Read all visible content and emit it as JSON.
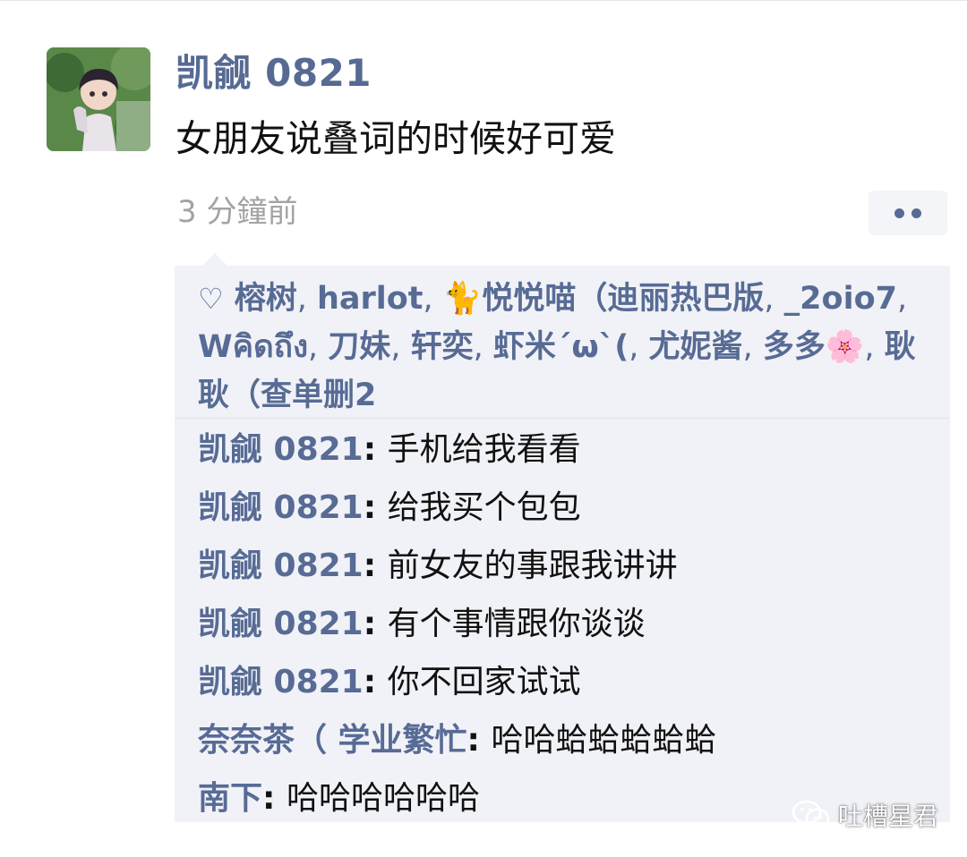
{
  "post": {
    "author": "凯觎 0821",
    "text": "女朋友说叠词的时候好可爱",
    "timestamp": "3 分鐘前"
  },
  "icons": {
    "avatar": "anime-character-avatar",
    "more": "more-dots-icon",
    "like": "heart-outline-icon"
  },
  "likes": {
    "names": [
      "榕树",
      "harlot",
      "🐈悦悦喵（迪丽热巴版",
      "_2oio7",
      "Wคิดถึง",
      "刀妹",
      "轩奕",
      "虾米´ω`(",
      "尤妮酱",
      "多多🌸",
      "耿耿（查单删2"
    ]
  },
  "comments": [
    {
      "author": "凯觎 0821",
      "text": "手机给我看看"
    },
    {
      "author": "凯觎 0821",
      "text": "给我买个包包"
    },
    {
      "author": "凯觎 0821",
      "text": "前女友的事跟我讲讲"
    },
    {
      "author": "凯觎 0821",
      "text": "有个事情跟你谈谈"
    },
    {
      "author": "凯觎 0821",
      "text": "你不回家试试"
    },
    {
      "author": "奈奈茶（ 学业繁忙",
      "text": "哈哈蛤蛤蛤蛤蛤"
    },
    {
      "author": "南下",
      "text": "哈哈哈哈哈哈"
    }
  ],
  "watermark": "吐槽星君",
  "colors": {
    "link": "#576b95",
    "text": "#111111",
    "muted": "#a3a3a3",
    "panel": "#f1f2f7"
  }
}
